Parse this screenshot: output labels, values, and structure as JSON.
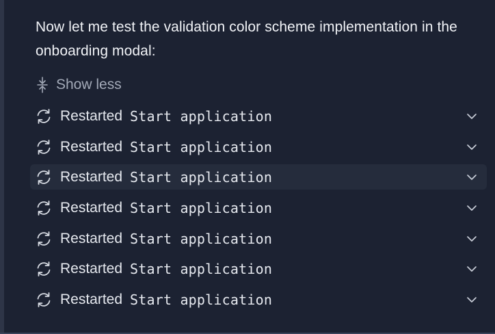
{
  "message": {
    "text": "Now let me test the validation color scheme implementation in the onboarding modal:"
  },
  "toggle": {
    "label": "Show less",
    "icon": "collapse-icon"
  },
  "rows": [
    {
      "status": "Restarted",
      "detail": "Start application",
      "icon": "restart-icon"
    },
    {
      "status": "Restarted",
      "detail": "Start application",
      "icon": "restart-icon"
    },
    {
      "status": "Restarted",
      "detail": "Start application",
      "icon": "restart-icon"
    },
    {
      "status": "Restarted",
      "detail": "Start application",
      "icon": "restart-icon"
    },
    {
      "status": "Restarted",
      "detail": "Start application",
      "icon": "restart-icon"
    },
    {
      "status": "Restarted",
      "detail": "Start application",
      "icon": "restart-icon"
    },
    {
      "status": "Restarted",
      "detail": "Start application",
      "icon": "restart-icon"
    }
  ],
  "colors": {
    "background": "#1c2232",
    "hover_row": "#252c3c",
    "text": "#e6e9ef",
    "muted_text": "#a3aab8"
  }
}
